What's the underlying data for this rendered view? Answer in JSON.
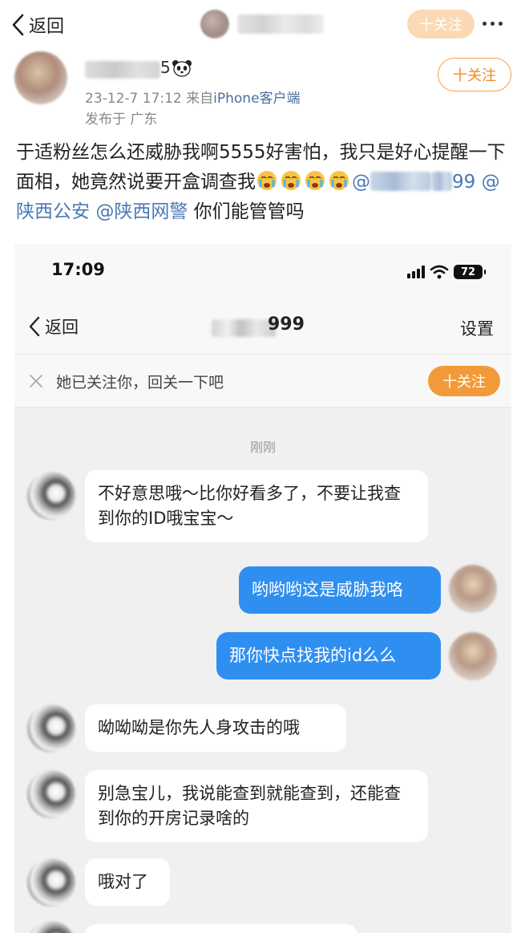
{
  "topbar": {
    "back_label": "返回",
    "follow_label": "十关注"
  },
  "post": {
    "name_tail": "5",
    "date": "23-12-7 17:12",
    "source_prefix": "来自",
    "source_client": "iPhone客户端",
    "location": "发布于 广东",
    "follow_label": "十关注",
    "text_part1": "于适粉丝怎么还威胁我啊5555好害怕，我只是好心提醒一下面相，她竟然说要开盒调查我",
    "mention_at": "@",
    "mention_tail": "99",
    "mention_2": "@陕西公安",
    "mention_3": "@陕西网警",
    "text_part2": " 你们能管管吗"
  },
  "screenshot": {
    "status": {
      "time": "17:09",
      "battery": "72"
    },
    "nav": {
      "back_label": "返回",
      "title": "999",
      "settings": "设置"
    },
    "notice": {
      "text": "她已关注你，回关一下吧",
      "follow_label": "十关注"
    },
    "chat": {
      "time_label": "刚刚",
      "messages": [
        {
          "side": "in",
          "text": "不好意思哦～比你好看多了，不要让我查到你的ID哦宝宝～"
        },
        {
          "side": "out",
          "text": "哟哟哟这是威胁我咯"
        },
        {
          "side": "out",
          "text": "那你快点找我的id么么"
        },
        {
          "side": "in",
          "text": "呦呦呦是你先人身攻击的哦"
        },
        {
          "side": "in",
          "text": "别急宝儿，我说能查到就能查到，还能查到你的开房记录啥的"
        },
        {
          "side": "in",
          "text": "哦对了"
        }
      ]
    }
  },
  "colors": {
    "accent_orange": "#f29a3a",
    "link_blue": "#4a78b5",
    "bubble_blue": "#2f8ff0"
  }
}
